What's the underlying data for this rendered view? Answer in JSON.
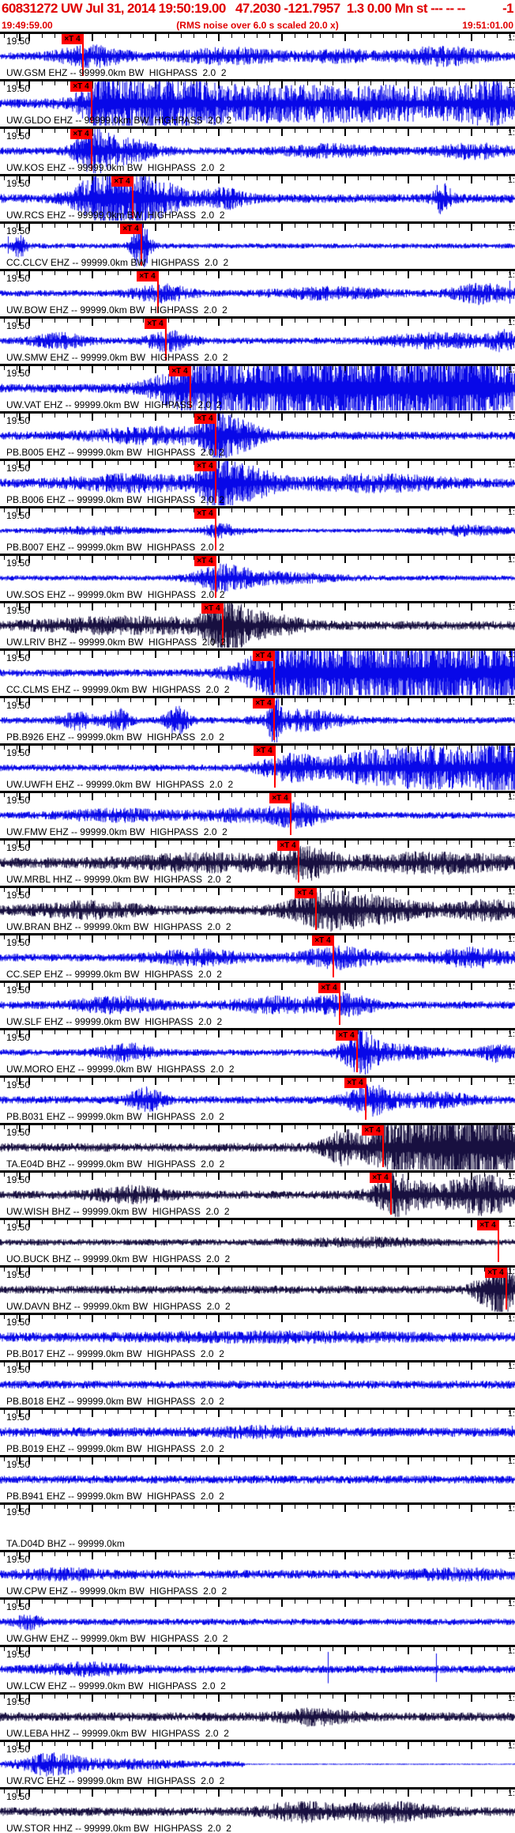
{
  "app": {
    "title_left": "60831272 UW Jul 31, 2014 19:50:19.00   47.2030 -121.7957  1.3 0.00 Mn st --- -- --",
    "title_right": "-1",
    "window_start": "19:49:59.00",
    "scale_note": "(RMS noise over 6.0 s scaled 20.0 x)",
    "window_end": "19:51:01.00"
  },
  "row_defaults": {
    "start_time": "19:50",
    "end_time_clipped": "1:",
    "pick_label": "×T 4"
  },
  "palette": {
    "header_red": "#e00000",
    "pick_red": "#ff0000",
    "trace_blue": "#0808e8",
    "trace_dark": "#181040"
  },
  "rows": [
    {
      "label": "UW.GSM EHZ -- 99999.0km BW  HIGHPASS  2.0  2",
      "color": "blue",
      "pick": 105,
      "noise": 2.5,
      "bursts": [
        [
          115,
          30,
          6
        ],
        [
          290,
          50,
          4
        ],
        [
          430,
          30,
          3
        ],
        [
          560,
          40,
          5
        ]
      ]
    },
    {
      "label": "UW.GLDO EHZ -- 99999.0km BW  HIGHPASS  2.0  2",
      "color": "blue",
      "pick": 116,
      "noise": 3,
      "bursts": [
        [
          135,
          22,
          13
        ],
        [
          200,
          50,
          12
        ],
        [
          330,
          100,
          9
        ],
        [
          520,
          90,
          8
        ],
        [
          625,
          30,
          10
        ]
      ]
    },
    {
      "label": "UW.KOS EHZ -- 99999.0km BW  HIGHPASS  2.0  2",
      "color": "blue",
      "pick": 116,
      "noise": 2.5,
      "bursts": [
        [
          118,
          15,
          12
        ],
        [
          155,
          30,
          7
        ],
        [
          420,
          40,
          3
        ],
        [
          600,
          30,
          4
        ]
      ]
    },
    {
      "label": "UW.RCS EHZ -- 99999.0km BW  HIGHPASS  2.0  2",
      "color": "blue",
      "pick": 168,
      "noise": 3,
      "bursts": [
        [
          130,
          25,
          12
        ],
        [
          175,
          35,
          16
        ],
        [
          285,
          20,
          5
        ],
        [
          560,
          8,
          9
        ]
      ],
      "spikes": [
        [
          117,
          20
        ],
        [
          160,
          23
        ],
        [
          563,
          14
        ]
      ]
    },
    {
      "label": "CC.CLCV EHZ -- 99999.0km BW  HIGHPASS  2.0  2",
      "color": "blue",
      "pick": 179,
      "noise": 1.8,
      "bursts": [
        [
          179,
          8,
          16
        ],
        [
          25,
          6,
          8
        ]
      ],
      "spikes": [
        [
          10,
          12
        ],
        [
          179,
          20
        ]
      ]
    },
    {
      "label": "UW.BOW EHZ -- 99999.0km BW  HIGHPASS  2.0  2",
      "color": "blue",
      "pick": 200,
      "noise": 2.2,
      "bursts": [
        [
          205,
          25,
          5
        ],
        [
          420,
          50,
          3
        ],
        [
          610,
          25,
          6
        ]
      ],
      "spikes": [
        [
          645,
          16
        ]
      ]
    },
    {
      "label": "UW.SMW EHZ -- 99999.0km BW  HIGHPASS  2.0  2",
      "color": "blue",
      "pick": 210,
      "noise": 2.2,
      "bursts": [
        [
          213,
          20,
          6
        ],
        [
          75,
          25,
          4
        ],
        [
          555,
          50,
          4
        ],
        [
          640,
          15,
          5
        ]
      ]
    },
    {
      "label": "UW.VAT EHZ -- 99999.0km BW  HIGHPASS  2.0  2",
      "color": "blue",
      "pick": 241,
      "noise": 3,
      "bursts": [
        [
          250,
          35,
          14
        ],
        [
          360,
          70,
          18
        ],
        [
          480,
          80,
          20
        ],
        [
          600,
          50,
          20
        ]
      ]
    },
    {
      "label": "PB.B005 EHZ -- 99999.0km BW  HIGHPASS  2.0  2",
      "color": "blue",
      "pick": 273,
      "noise": 2.8,
      "bursts": [
        [
          274,
          10,
          15
        ],
        [
          295,
          25,
          9
        ],
        [
          200,
          60,
          4
        ]
      ]
    },
    {
      "label": "PB.B006 EHZ -- 99999.0km BW  HIGHPASS  2.0  2",
      "color": "blue",
      "pick": 273,
      "noise": 3,
      "bursts": [
        [
          276,
          12,
          16
        ],
        [
          305,
          30,
          10
        ],
        [
          170,
          60,
          4
        ],
        [
          470,
          70,
          4
        ]
      ]
    },
    {
      "label": "PB.B007 EHZ -- 99999.0km BW  HIGHPASS  2.0  2",
      "color": "blue",
      "pick": 273,
      "noise": 1.4,
      "bursts": [
        [
          281,
          20,
          4
        ],
        [
          120,
          50,
          2
        ],
        [
          590,
          40,
          3
        ]
      ]
    },
    {
      "label": "UW.SOS EHZ -- 99999.0km BW  HIGHPASS  2.0  2",
      "color": "blue",
      "pick": 273,
      "noise": 1.8,
      "bursts": [
        [
          281,
          25,
          7
        ],
        [
          350,
          50,
          3
        ]
      ]
    },
    {
      "label": "UW.LRIV BHZ -- 99999.0km BW  HIGHPASS  2.0  2",
      "color": "dark",
      "pick": 282,
      "noise": 3,
      "bursts": [
        [
          284,
          14,
          18
        ],
        [
          320,
          40,
          7
        ],
        [
          160,
          80,
          4
        ]
      ]
    },
    {
      "label": "CC.CLMS EHZ -- 99999.0km BW  HIGHPASS  2.0  2",
      "color": "blue",
      "pick": 347,
      "noise": 2.5,
      "bursts": [
        [
          360,
          35,
          14
        ],
        [
          455,
          70,
          19
        ],
        [
          580,
          60,
          17
        ],
        [
          640,
          15,
          15
        ]
      ]
    },
    {
      "label": "PB.B926 EHZ -- 99999.0km BW  HIGHPASS  2.0  2",
      "color": "blue",
      "pick": 347,
      "noise": 2.2,
      "bursts": [
        [
          347,
          5,
          17
        ],
        [
          385,
          35,
          6
        ],
        [
          100,
          15,
          5
        ],
        [
          150,
          10,
          7
        ],
        [
          225,
          10,
          9
        ]
      ]
    },
    {
      "label": "UW.UWFH EHZ -- 99999.0km BW  HIGHPASS  2.0  2",
      "color": "blue",
      "pick": 348,
      "noise": 2.3,
      "bursts": [
        [
          365,
          25,
          7
        ],
        [
          460,
          50,
          7
        ],
        [
          565,
          60,
          12
        ],
        [
          635,
          20,
          15
        ]
      ]
    },
    {
      "label": "UW.FMW EHZ -- 99999.0km BW  HIGHPASS  2.0  2",
      "color": "blue",
      "pick": 368,
      "noise": 2.3,
      "bursts": [
        [
          378,
          25,
          7
        ],
        [
          150,
          50,
          3
        ],
        [
          300,
          40,
          3
        ]
      ]
    },
    {
      "label": "UW.MRBL HHZ -- 99999.0km BW  HIGHPASS  2.0  2",
      "color": "dark",
      "pick": 378,
      "noise": 3.5,
      "bursts": [
        [
          388,
          25,
          8
        ],
        [
          260,
          70,
          4
        ],
        [
          550,
          70,
          5
        ]
      ]
    },
    {
      "label": "UW.BRAN BHZ -- 99999.0km BW  HIGHPASS  2.0  2",
      "color": "dark",
      "pick": 400,
      "noise": 3,
      "bursts": [
        [
          412,
          35,
          9
        ],
        [
          480,
          50,
          6
        ],
        [
          110,
          50,
          4
        ],
        [
          620,
          30,
          5
        ]
      ]
    },
    {
      "label": "CC.SEP EHZ -- 99999.0km BW  HIGHPASS  2.0  2",
      "color": "blue",
      "pick": 422,
      "noise": 2.6,
      "bursts": [
        [
          432,
          35,
          6
        ],
        [
          250,
          40,
          4
        ],
        [
          600,
          35,
          5
        ]
      ]
    },
    {
      "label": "UW.SLF EHZ -- 99999.0km BW  HIGHPASS  2.0  2",
      "color": "blue",
      "pick": 430,
      "noise": 2.6,
      "bursts": [
        [
          438,
          25,
          6
        ],
        [
          150,
          40,
          4
        ],
        [
          350,
          40,
          4
        ]
      ]
    },
    {
      "label": "UW.MORO EHZ -- 99999.0km BW  HIGHPASS  2.0  2",
      "color": "blue",
      "pick": 452,
      "noise": 2.2,
      "bursts": [
        [
          455,
          15,
          13
        ],
        [
          500,
          40,
          4
        ],
        [
          160,
          25,
          5
        ],
        [
          630,
          15,
          5
        ]
      ]
    },
    {
      "label": "PB.B031 EHZ -- 99999.0km BW  HIGHPASS  2.0  2",
      "color": "blue",
      "pick": 463,
      "noise": 2.6,
      "bursts": [
        [
          467,
          20,
          9
        ],
        [
          185,
          15,
          7
        ],
        [
          545,
          35,
          4
        ]
      ]
    },
    {
      "label": "TA.E04D BHZ -- 99999.0km BW  HIGHPASS  2.0  2",
      "color": "dark",
      "pick": 485,
      "noise": 3,
      "bursts": [
        [
          492,
          20,
          14
        ],
        [
          545,
          28,
          19
        ],
        [
          595,
          28,
          21
        ],
        [
          635,
          18,
          19
        ],
        [
          435,
          18,
          10
        ]
      ]
    },
    {
      "label": "UW.WISH BHZ -- 99999.0km BW  HIGHPASS  2.0  2",
      "color": "dark",
      "pick": 495,
      "noise": 2.8,
      "bursts": [
        [
          500,
          15,
          11
        ],
        [
          555,
          50,
          7
        ],
        [
          620,
          25,
          9
        ],
        [
          165,
          35,
          4
        ]
      ]
    },
    {
      "label": "UO.BUCK BHZ -- 99999.0km BW  HIGHPASS  2.0  2",
      "color": "dark",
      "pick": 631,
      "noise": 2.2,
      "bursts": [
        [
          460,
          60,
          2
        ]
      ]
    },
    {
      "label": "UW.DAVN BHZ -- 99999.0km BW  HIGHPASS  2.0  2",
      "color": "dark",
      "pick": 641,
      "noise": 2.8,
      "bursts": [
        [
          638,
          10,
          18
        ],
        [
          615,
          12,
          8
        ]
      ]
    },
    {
      "label": "PB.B017 EHZ -- 99999.0km BW  HIGHPASS  2.0  2",
      "color": "blue",
      "pick": null,
      "noise": 3.2,
      "bursts": [
        [
          350,
          120,
          1.5
        ]
      ]
    },
    {
      "label": "PB.B018 EHZ -- 99999.0km BW  HIGHPASS  2.0  2",
      "color": "blue",
      "pick": null,
      "noise": 2.8,
      "bursts": []
    },
    {
      "label": "PB.B019 EHZ -- 99999.0km BW  HIGHPASS  2.0  2",
      "color": "blue",
      "pick": null,
      "noise": 3.2,
      "bursts": [
        [
          330,
          40,
          2
        ]
      ],
      "spikes": [
        [
          648,
          8
        ]
      ]
    },
    {
      "label": "PB.B941 EHZ -- 99999.0km BW  HIGHPASS  2.0  2",
      "color": "blue",
      "pick": null,
      "noise": 2.8,
      "bursts": []
    },
    {
      "label": "TA.D04D BHZ -- 99999.0km",
      "color": "none",
      "pick": null,
      "noise": 0,
      "bursts": []
    },
    {
      "label": "UW.CPW EHZ -- 99999.0km BW  HIGHPASS  2.0  2",
      "color": "blue",
      "pick": null,
      "noise": 3,
      "bursts": [
        [
          80,
          40,
          2
        ],
        [
          580,
          50,
          2
        ]
      ]
    },
    {
      "label": "UW.GHW EHZ -- 99999.0km BW  HIGHPASS  2.0  2",
      "color": "blue",
      "pick": null,
      "noise": 2.2,
      "bursts": [
        [
          35,
          12,
          4
        ]
      ]
    },
    {
      "label": "UW.LCW EHZ -- 99999.0km BW  HIGHPASS  2.0  2",
      "color": "blue",
      "pick": null,
      "noise": 2.6,
      "bursts": [
        [
          110,
          40,
          3
        ]
      ],
      "spikes": [
        [
          415,
          22
        ],
        [
          552,
          20
        ]
      ]
    },
    {
      "label": "UW.LEBA HHZ -- 99999.0km BW  HIGHPASS  2.0  2",
      "color": "dark",
      "pick": null,
      "noise": 3,
      "bursts": [
        [
          400,
          30,
          4
        ]
      ]
    },
    {
      "label": "UW.RVC EHZ -- 99999.0km BW  HIGHPASS  2.0  2",
      "color": "blue",
      "pick": null,
      "noise": 2,
      "bursts": [
        [
          65,
          25,
          6
        ],
        [
          150,
          60,
          2
        ]
      ],
      "flat_from": 310
    },
    {
      "label": "UW.STOR HHZ -- 99999.0km BW  HIGHPASS  2.0  2",
      "color": "dark",
      "pick": null,
      "noise": 3,
      "bursts": [
        [
          380,
          30,
          5
        ],
        [
          490,
          40,
          5
        ]
      ]
    }
  ]
}
